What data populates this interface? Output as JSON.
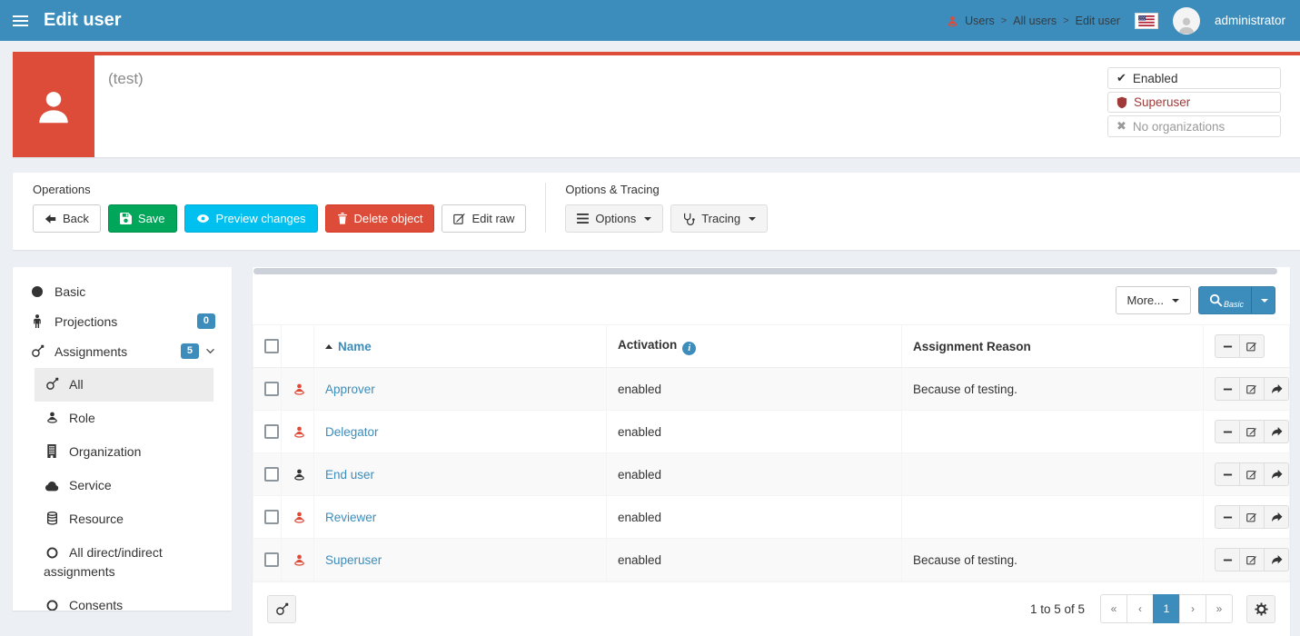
{
  "header": {
    "title": "Edit user",
    "breadcrumb": [
      "Users",
      "All users",
      "Edit user"
    ],
    "separator": ">",
    "username": "administrator"
  },
  "summary": {
    "display_name": "(test)",
    "tags": [
      {
        "label": "Enabled",
        "icon": "check"
      },
      {
        "label": "Superuser",
        "icon": "shield"
      },
      {
        "label": "No organizations",
        "icon": "x"
      }
    ]
  },
  "glyphs": {
    "check": "✔",
    "x": "✖"
  },
  "operations": {
    "title": "Operations",
    "back": "Back",
    "save": "Save",
    "preview": "Preview changes",
    "delete": "Delete object",
    "edit_raw": "Edit raw",
    "options_title": "Options & Tracing",
    "options": "Options",
    "tracing": "Tracing"
  },
  "sidebar": {
    "items": [
      {
        "label": "Basic"
      },
      {
        "label": "Projections",
        "badge": "0"
      },
      {
        "label": "Assignments",
        "badge": "5"
      }
    ],
    "submenu": [
      {
        "label": "All"
      },
      {
        "label": "Role"
      },
      {
        "label": "Organization"
      },
      {
        "label": "Service"
      },
      {
        "label": "Resource"
      },
      {
        "label": "All direct/indirect assignments"
      },
      {
        "label": "Consents"
      }
    ]
  },
  "table": {
    "toolbar": {
      "more": "More...",
      "search_mode": "Basic"
    },
    "columns": {
      "name": "Name",
      "activation": "Activation",
      "reason": "Assignment Reason"
    },
    "rows": [
      {
        "name": "Approver",
        "activation": "enabled",
        "reason": "Because of testing.",
        "icon_color": "red"
      },
      {
        "name": "Delegator",
        "activation": "enabled",
        "reason": "",
        "icon_color": "red"
      },
      {
        "name": "End user",
        "activation": "enabled",
        "reason": "",
        "icon_color": "dark"
      },
      {
        "name": "Reviewer",
        "activation": "enabled",
        "reason": "",
        "icon_color": "red"
      },
      {
        "name": "Superuser",
        "activation": "enabled",
        "reason": "Because of testing.",
        "icon_color": "red"
      }
    ],
    "footer": {
      "count_label": "1 to 5 of 5",
      "first": "«",
      "prev": "‹",
      "page": "1",
      "next": "›",
      "last": "»"
    }
  },
  "colors": {
    "primary": "#3c8dbc",
    "success": "#00a65a",
    "info": "#00c0ef",
    "danger": "#dd4b39",
    "page_bg": "#ecf0f5"
  }
}
